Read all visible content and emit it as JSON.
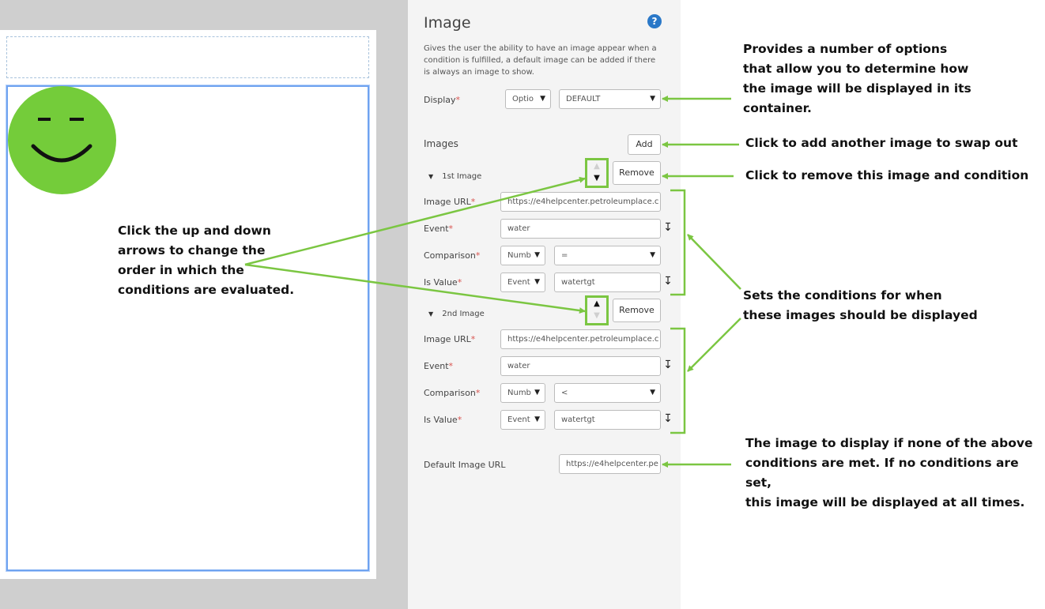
{
  "panel": {
    "title": "Image",
    "help_icon": "question-circle-icon",
    "description": "Gives the user the ability to have an image appear when a condition is fulfilled, a default image can be added if there is always an image to show.",
    "display": {
      "label": "Display",
      "required_mark": "*",
      "type_value": "Optio",
      "mode_value": "DEFAULT"
    },
    "images": {
      "label": "Images",
      "add_label": "Add",
      "items": [
        {
          "title": "1st Image",
          "remove_label": "Remove",
          "url_label": "Image URL",
          "url_value": "https://e4helpcenter.petroleumplace.c",
          "event_label": "Event",
          "event_value": "water",
          "comparison_label": "Comparison",
          "comparison_type": "Numb",
          "comparison_op": "=",
          "isvalue_label": "Is Value",
          "isvalue_type": "Event",
          "isvalue_value": "watertgt"
        },
        {
          "title": "2nd Image",
          "remove_label": "Remove",
          "url_label": "Image URL",
          "url_value": "https://e4helpcenter.petroleumplace.c",
          "event_label": "Event",
          "event_value": "water",
          "comparison_label": "Comparison",
          "comparison_type": "Numb",
          "comparison_op": "<",
          "isvalue_label": "Is Value",
          "isvalue_type": "Event",
          "isvalue_value": "watertgt"
        }
      ]
    },
    "default_url": {
      "label": "Default Image URL",
      "value": "https://e4helpcenter.pe"
    }
  },
  "annotations": {
    "display_options": [
      "Provides a number of options",
      "that allow you to determine how",
      "the image will be displayed in its",
      "container."
    ],
    "add": "Click to add another image to swap out",
    "remove": "Click to remove this image and condition",
    "order": [
      "Click the up and down",
      "arrows to change the",
      "order in which the",
      "conditions are evaluated."
    ],
    "conditions": [
      "Sets the conditions for when",
      "these images should be displayed"
    ],
    "default": [
      "The image to display if none of the above",
      "conditions are met. If no conditions are set,",
      "this image will be displayed at all times."
    ]
  },
  "colors": {
    "accent_green": "#7bc642",
    "smiley_green": "#74cc3a",
    "selection_blue": "#6fa3f0",
    "help_blue": "#2a78c8",
    "required_red": "#d9534f"
  }
}
